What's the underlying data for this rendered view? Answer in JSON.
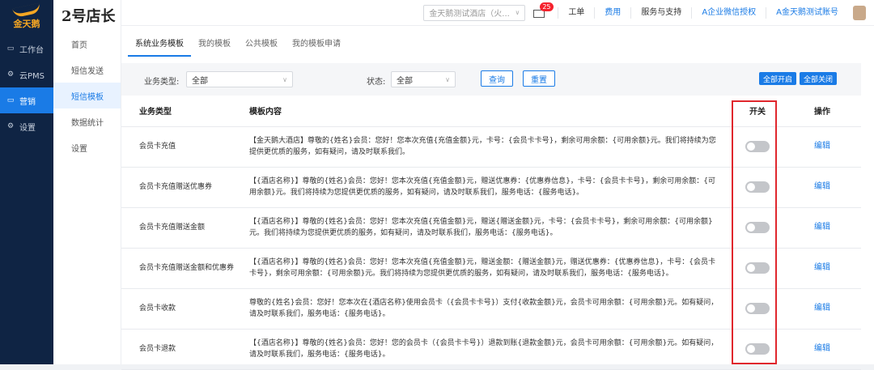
{
  "sidebar": {
    "logo_text": "金天鹅",
    "items": [
      {
        "label": "工作台",
        "icon": "workbench-icon"
      },
      {
        "label": "云PMS",
        "icon": "gear-icon"
      },
      {
        "label": "营销",
        "icon": "marketing-icon"
      },
      {
        "label": "设置",
        "icon": "gear-icon"
      }
    ]
  },
  "brand": "2号店长",
  "subnav": {
    "items": [
      "首页",
      "短信发送",
      "短信模板",
      "数据统计",
      "设置"
    ],
    "active": "短信模板"
  },
  "topbar": {
    "hotel": "金天鹅测试酒店（火...",
    "mail_badge": "25",
    "links": [
      "工单",
      "费用",
      "服务与支持",
      "A企业微信授权",
      "A金天鹅测试账号"
    ]
  },
  "tabs": [
    "系统业务模板",
    "我的模板",
    "公共模板",
    "我的模板申请"
  ],
  "filter": {
    "type_label": "业务类型:",
    "type_value": "全部",
    "status_label": "状态:",
    "status_value": "全部",
    "query_label": "查询",
    "reset_label": "重置",
    "open_all_label": "全部开启",
    "close_all_label": "全部关闭"
  },
  "table": {
    "headers": [
      "业务类型",
      "模板内容",
      "开关",
      "操作"
    ],
    "edit_label": "编辑",
    "rows": [
      {
        "type": "会员卡充值",
        "content": "【金天鹅大酒店】尊敬的{姓名}会员：您好！您本次充值{充值金额}元，卡号：{会员卡卡号}，剩余可用余额：{可用余额}元。我们将持续为您提供更优质的服务，如有疑问，请及时联系我们。",
        "switch_on": false
      },
      {
        "type": "会员卡充值赠送优惠券",
        "content": "【{酒店名称}】尊敬的{姓名}会员：您好！您本次充值{充值金额}元，赠送优惠券：{优惠券信息}，卡号：{会员卡卡号}，剩余可用余额：{可用余额}元。我们将持续为您提供更优质的服务，如有疑问，请及时联系我们，服务电话：{服务电话}。",
        "switch_on": false
      },
      {
        "type": "会员卡充值赠送金额",
        "content": "【{酒店名称}】尊敬的{姓名}会员：您好！您本次充值{充值金额}元，赠送{赠送金额}元，卡号：{会员卡卡号}，剩余可用余额：{可用余额}元。我们将持续为您提供更优质的服务，如有疑问，请及时联系我们，服务电话：{服务电话}。",
        "switch_on": false
      },
      {
        "type": "会员卡充值赠送金额和优惠券",
        "content": "【{酒店名称}】尊敬的{姓名}会员：您好！您本次充值{充值金额}元，赠送金额：{赠送金额}元，赠送优惠券：{优惠券信息}，卡号：{会员卡卡号}，剩余可用余额：{可用余额}元。我们将持续为您提供更优质的服务，如有疑问，请及时联系我们，服务电话：{服务电话}。",
        "switch_on": false
      },
      {
        "type": "会员卡收款",
        "content": "尊敬的{姓名}会员：您好！您本次在{酒店名称}使用会员卡（{会员卡卡号}）支付{收款金额}元，会员卡可用余额：{可用余额}元。如有疑问，请及时联系我们，服务电话：{服务电话}。",
        "switch_on": false
      },
      {
        "type": "会员卡退款",
        "content": "【{酒店名称}】尊敬的{姓名}会员：您好！您的会员卡（{会员卡卡号}）退款到账{退款金额}元，会员卡可用余额：{可用余额}元。如有疑问，请及时联系我们，服务电话：{服务电话}。",
        "switch_on": false
      }
    ]
  }
}
